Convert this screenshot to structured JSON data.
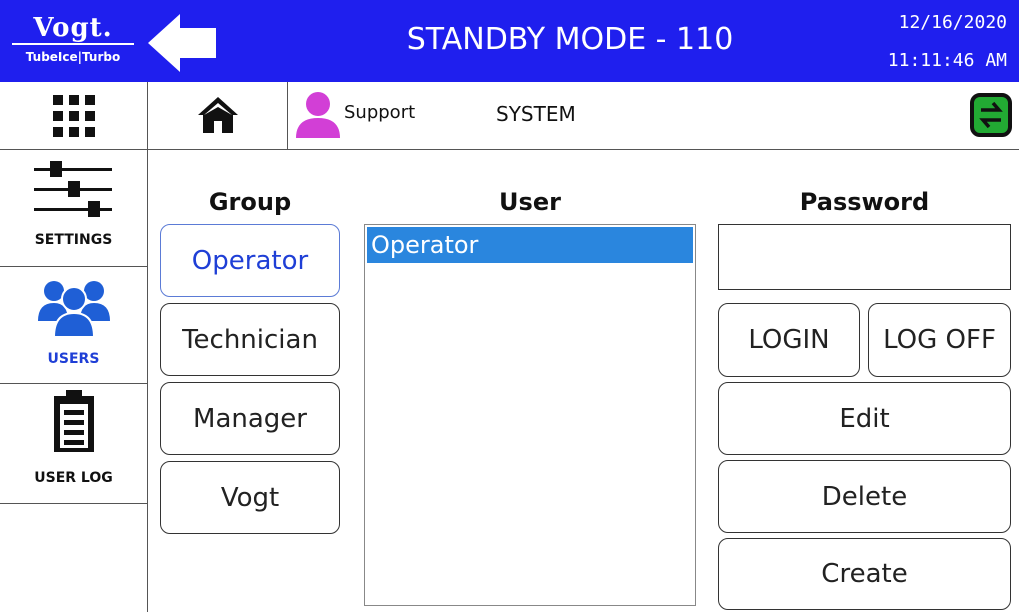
{
  "header": {
    "logo_brand": "Vogt.",
    "logo_sub": "TubeIce|Turbo",
    "title": "STANDBY MODE - 110",
    "date": "12/16/2020",
    "time": "11:11:46 AM",
    "bg_color": "#1f1fee"
  },
  "sidebar": {
    "items": [
      {
        "label": "",
        "icon": "grid-icon"
      },
      {
        "label": "SETTINGS",
        "icon": "sliders-icon"
      },
      {
        "label": "USERS",
        "icon": "users-icon",
        "active": true
      },
      {
        "label": "USER LOG",
        "icon": "clipboard-icon"
      }
    ]
  },
  "toolbar": {
    "home_icon": "home-icon",
    "user_icon": "user-icon",
    "user_name": "Support",
    "section": "SYSTEM",
    "swap_icon": "swap-icon"
  },
  "groups": {
    "header": "Group",
    "items": [
      "Operator",
      "Technician",
      "Manager",
      "Vogt"
    ],
    "selected": "Operator"
  },
  "users": {
    "header": "User",
    "items": [
      "Operator"
    ],
    "selected": "Operator"
  },
  "password": {
    "header": "Password",
    "value": ""
  },
  "actions": {
    "login": "LOGIN",
    "logoff": "LOG OFF",
    "edit": "Edit",
    "delete": "Delete",
    "create": "Create"
  },
  "colors": {
    "accent": "#1f3fd6",
    "selected_row": "#2a86de",
    "user_avatar": "#d23fd6",
    "swap_icon": "#22aa33"
  }
}
